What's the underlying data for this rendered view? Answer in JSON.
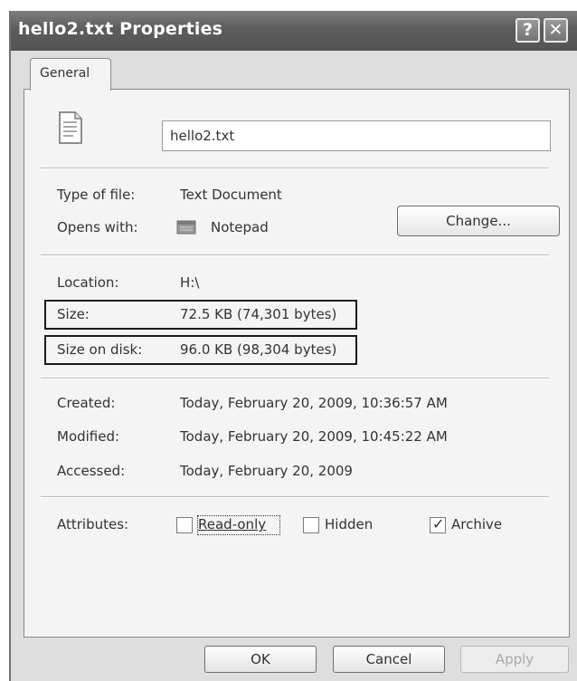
{
  "window": {
    "title": "hello2.txt Properties",
    "help_glyph": "?",
    "close_glyph": "✕"
  },
  "tabs": [
    {
      "label": "General",
      "selected": true
    }
  ],
  "file": {
    "name_value": "hello2.txt",
    "icon": "text-file-icon"
  },
  "details": {
    "type_label": "Type of file:",
    "type_value": "Text Document",
    "opens_label": "Opens with:",
    "opens_value": "Notepad",
    "opens_icon": "notepad-icon",
    "change_button": "Change...",
    "location_label": "Location:",
    "location_value": "H:\\",
    "size_label": "Size:",
    "size_value": "72.5 KB (74,301 bytes)",
    "size_on_disk_label": "Size on disk:",
    "size_on_disk_value": "96.0 KB (98,304 bytes)",
    "created_label": "Created:",
    "created_value": "Today, February 20, 2009, 10:36:57 AM",
    "modified_label": "Modified:",
    "modified_value": "Today, February 20, 2009, 10:45:22 AM",
    "accessed_label": "Accessed:",
    "accessed_value": "Today, February 20, 2009"
  },
  "attributes": {
    "label": "Attributes:",
    "read_only": {
      "label": "Read-only",
      "checked": false
    },
    "hidden": {
      "label": "Hidden",
      "checked": false
    },
    "archive": {
      "label": "Archive",
      "checked": true
    }
  },
  "buttons": {
    "ok": "OK",
    "cancel": "Cancel",
    "apply": "Apply"
  },
  "highlight_color": "#1a1a1a"
}
